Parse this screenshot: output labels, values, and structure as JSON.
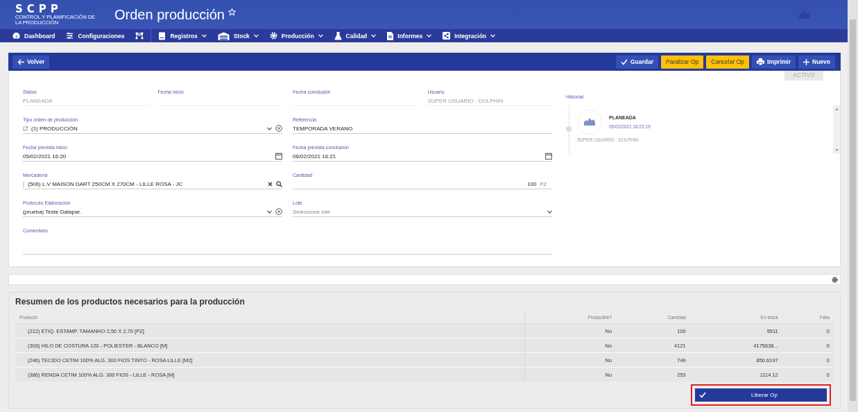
{
  "app": {
    "logo": "SCPP",
    "logo_subtitle": "CONTROL Y PLANIFICACIÓN DE LA PRODUCCIÓN",
    "title": "Orden producción",
    "favorite": false
  },
  "nav": [
    {
      "label": "Dashboard",
      "kind": "gauge",
      "dropdown": false
    },
    {
      "label": "Configuraciones",
      "kind": "sliders",
      "dropdown": false
    },
    {
      "kind": "network",
      "dropdown": false
    },
    {
      "label": "Registros",
      "kind": "book",
      "dropdown": true
    },
    {
      "label": "Stock",
      "kind": "warehouse",
      "dropdown": true
    },
    {
      "label": "Producción",
      "kind": "gear",
      "dropdown": true
    },
    {
      "label": "Calidad",
      "kind": "flask",
      "dropdown": true
    },
    {
      "label": "Informes",
      "kind": "file",
      "dropdown": true
    },
    {
      "label": "Integración",
      "kind": "share",
      "dropdown": true
    }
  ],
  "toolbar": {
    "back": "Volver",
    "actions": [
      {
        "label": "Guardar",
        "kind": "save"
      },
      {
        "label": "Paralizar Op",
        "kind": "warning"
      },
      {
        "label": "Cancelar Op",
        "kind": "warning"
      },
      {
        "label": "Imprimir",
        "kind": "print"
      },
      {
        "label": "Nuevo",
        "kind": "new"
      }
    ]
  },
  "status_badge": "ACTIVO",
  "fields": [
    {
      "label": "Status",
      "kind": "readonly",
      "value": "PLANEADA"
    },
    {
      "label": "Fecha inicio",
      "kind": "readonly"
    },
    {
      "label": "Fecha conclusión",
      "kind": "readonly"
    },
    {
      "label": "Usuario",
      "kind": "readonly",
      "value": "SUPER USUARIO - DOLPHIN"
    },
    {
      "label": "Tipo orden de producción",
      "kind": "select",
      "value": "(1) PRODUCCIÓN",
      "clearable": true,
      "linked": true
    },
    {
      "label": "Referencia",
      "kind": "text",
      "value": "TEMPORADA VERANO"
    },
    {
      "label": "Fecha prevista inicio",
      "kind": "date",
      "value": "05/02/2021 16:20"
    },
    {
      "label": "Fecha prevista conclusión",
      "kind": "date",
      "value": "06/02/2021 16:21"
    },
    {
      "label": "Mercadería",
      "kind": "search",
      "value": "(506) L.V MAISON DART 250CM X 270CM - LILLE ROSA - JC"
    },
    {
      "label": "Cantidad",
      "kind": "number",
      "value": "100",
      "unit": "PZ"
    },
    {
      "label": "Protocolo Elaboración",
      "kind": "select",
      "value": "(prueba) Teste Datapar.",
      "clearable": true,
      "linked": false
    },
    {
      "label": "Lote",
      "kind": "select",
      "placeholder": "Seleccione lote",
      "clearable": false,
      "linked": false
    },
    {
      "label": "Comentario",
      "kind": "textarea"
    }
  ],
  "history": {
    "label": "Historial",
    "entries": [
      {
        "status": "PLANEADA",
        "time": "05/02/2021 16:23:19",
        "user": "SUPER USUARIO - DOLPHIN"
      }
    ]
  },
  "summary": {
    "title": "Resumen de los productos necesarios para la producción",
    "columns": [
      "Producto",
      "Producible?",
      "Cantidad",
      "En stock",
      "Falta"
    ],
    "rows": [
      [
        "(212) ETIQ. ESTAMP. TAMANHO 2,50 X 2,70 [PZ]",
        "No",
        "100",
        "5511",
        "0"
      ],
      [
        "(303) HILO DE COSTURA 120 - POLIESTER - BLANCO [M]",
        "No",
        "4121",
        "4175638...",
        "0"
      ],
      [
        "(246) TECIDO CETIM 100% ALG. 300 FIOS TINTO - ROSA LILLE [M2]",
        "No",
        "749",
        "850.6197",
        "0"
      ],
      [
        "(386) RENDA CETIM 100% ALG. 300 FIOS - LILLE - ROSA [M]",
        "No",
        "253",
        "1114.12",
        "0"
      ]
    ],
    "button": {
      "label": "Liberar Op",
      "highlighted": true
    }
  }
}
